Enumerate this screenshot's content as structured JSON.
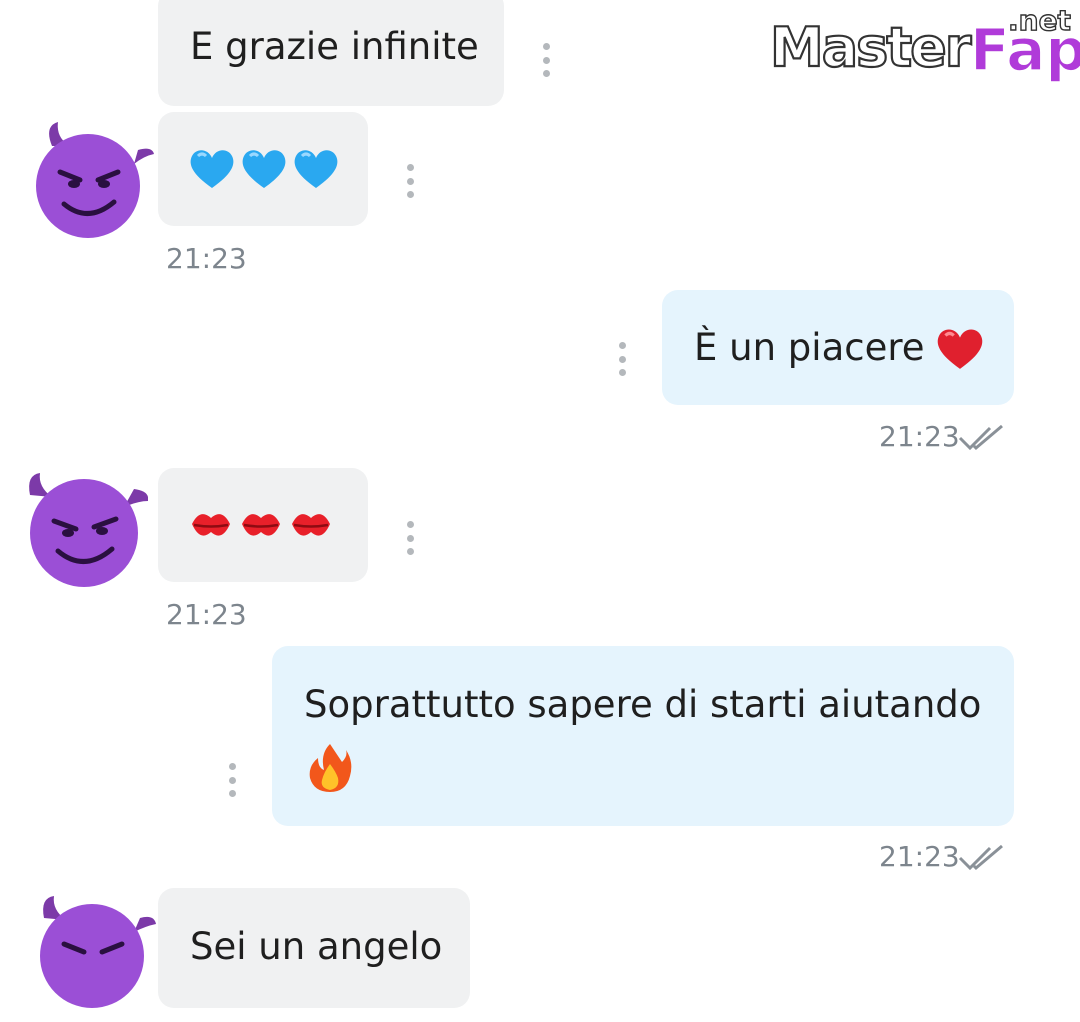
{
  "watermark": {
    "part1": "Master",
    "part2": "Fap",
    "suffix": ".net"
  },
  "messages": [
    {
      "direction": "incoming",
      "text": "E grazie infinite"
    },
    {
      "direction": "incoming",
      "emoji": [
        "blue-heart",
        "blue-heart",
        "blue-heart"
      ],
      "time": "21:23"
    },
    {
      "direction": "outgoing",
      "text": "È un piacere",
      "emoji": [
        "red-heart"
      ],
      "time": "21:23",
      "status": "read"
    },
    {
      "direction": "incoming",
      "emoji": [
        "kiss-mark",
        "kiss-mark",
        "kiss-mark"
      ],
      "time": "21:23"
    },
    {
      "direction": "outgoing",
      "text": "Soprattutto sapere di starti aiutando",
      "emoji": [
        "fire"
      ],
      "time": "21:23",
      "status": "read"
    },
    {
      "direction": "incoming",
      "text": "Sei un angelo"
    }
  ],
  "colors": {
    "incoming_bubble": "#f0f1f2",
    "outgoing_bubble": "#e5f4fd",
    "timestamp": "#7d858d",
    "avatar_purple": "#9b4fd6"
  },
  "avatar_icon": "smiling-face-with-horns-icon"
}
